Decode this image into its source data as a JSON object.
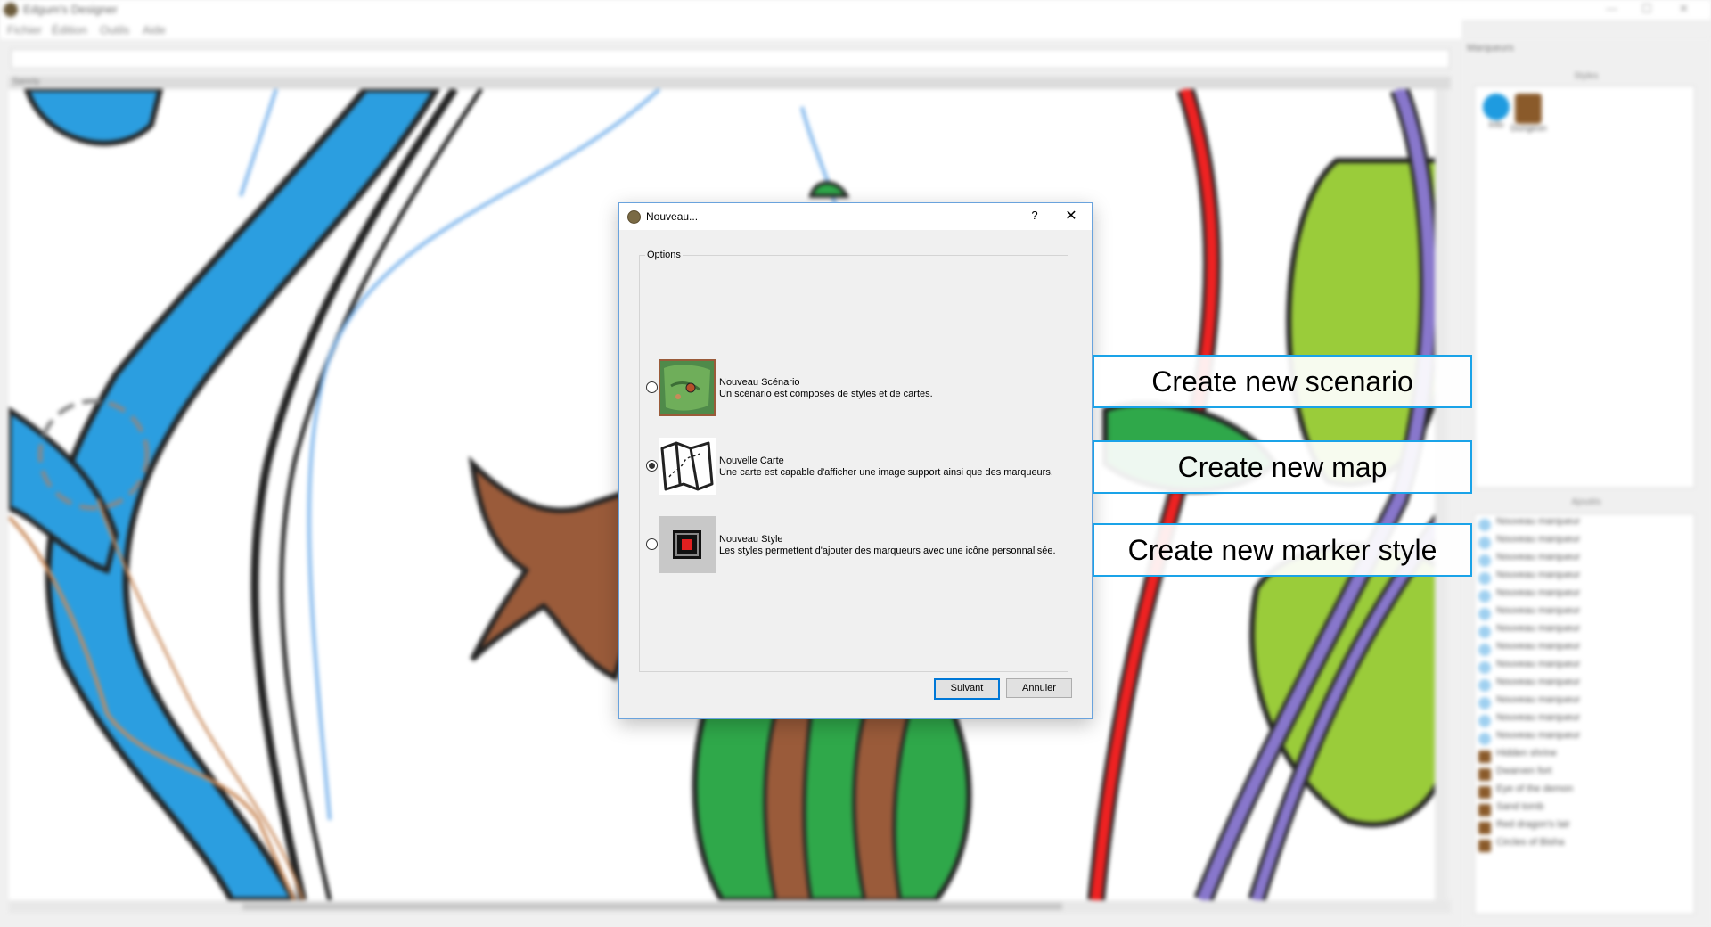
{
  "app": {
    "title": "Edgum's Designer",
    "window_controls": [
      "—",
      "☐",
      "✕"
    ]
  },
  "menu": [
    "Fichier",
    "Édition",
    "Outils",
    "Aide"
  ],
  "map_panel": {
    "label": "Sancty"
  },
  "right_panel": {
    "title": "Marqueurs",
    "styles_title": "Styles",
    "styles": [
      {
        "label": "Info",
        "icon": "info-icon",
        "color": "#1e9be0"
      },
      {
        "label": "Dungeon",
        "icon": "dungeon-icon",
        "color": "#8a5a2a"
      }
    ],
    "markers_title": "Ajoutés",
    "markers": [
      {
        "label": "Nouveau marqueur",
        "icon": "info-icon"
      },
      {
        "label": "Nouveau marqueur",
        "icon": "info-icon"
      },
      {
        "label": "Nouveau marqueur",
        "icon": "info-icon"
      },
      {
        "label": "Nouveau marqueur",
        "icon": "info-icon"
      },
      {
        "label": "Nouveau marqueur",
        "icon": "info-icon"
      },
      {
        "label": "Nouveau marqueur",
        "icon": "info-icon"
      },
      {
        "label": "Nouveau marqueur",
        "icon": "info-icon"
      },
      {
        "label": "Nouveau marqueur",
        "icon": "info-icon"
      },
      {
        "label": "Nouveau marqueur",
        "icon": "info-icon"
      },
      {
        "label": "Nouveau marqueur",
        "icon": "info-icon"
      },
      {
        "label": "Nouveau marqueur",
        "icon": "info-icon"
      },
      {
        "label": "Nouveau marqueur",
        "icon": "info-icon"
      },
      {
        "label": "Nouveau marqueur",
        "icon": "info-icon"
      },
      {
        "label": "Hidden shrine",
        "icon": "dungeon-icon"
      },
      {
        "label": "Dwarven fort",
        "icon": "dungeon-icon"
      },
      {
        "label": "Eye of the demon",
        "icon": "dungeon-icon"
      },
      {
        "label": "Sand tomb",
        "icon": "dungeon-icon"
      },
      {
        "label": "Red dragon's lair",
        "icon": "dungeon-icon"
      },
      {
        "label": "Circles of Bisha",
        "icon": "dungeon-icon"
      }
    ]
  },
  "dialog": {
    "title": "Nouveau...",
    "help_label": "?",
    "close_label": "✕",
    "group_label": "Options",
    "options": [
      {
        "title": "Nouveau Scénario",
        "description": "Un scénario est composés de styles et de cartes.",
        "icon": "scenario-map-icon",
        "selected": false
      },
      {
        "title": "Nouvelle Carte",
        "description": "Une carte est capable d'afficher une image support ainsi que des marqueurs.",
        "icon": "folded-map-icon",
        "selected": true
      },
      {
        "title": "Nouveau Style",
        "description": "Les styles permettent d'ajouter des marqueurs avec une icône personnalisée.",
        "icon": "marker-style-icon",
        "selected": false
      }
    ],
    "next_label": "Suivant",
    "cancel_label": "Annuler"
  },
  "callouts": [
    "Create new scenario",
    "Create new map",
    "Create new marker style"
  ],
  "colors": {
    "accent": "#0078d7",
    "callout_border": "#1aa3e8",
    "water": "#2b9ee0",
    "river": "#ee2222",
    "road": "#8877cc",
    "forest": "#2fa84a",
    "meadow": "#9acc3a",
    "tree": "#9a5b3a"
  }
}
